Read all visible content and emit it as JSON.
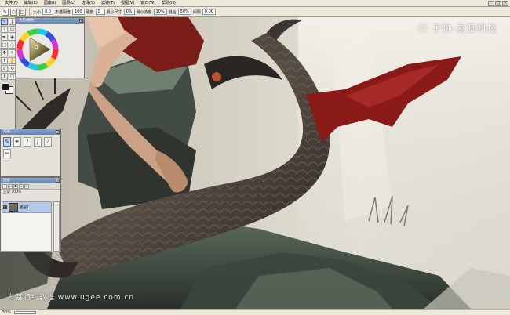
{
  "menubar": {
    "items": [
      "文件(F)",
      "编辑(E)",
      "图像(I)",
      "图层(L)",
      "选择(S)",
      "滤镜(T)",
      "视图(V)",
      "窗口(W)",
      "帮助(H)"
    ],
    "window_controls": [
      "_",
      "□",
      "×"
    ]
  },
  "optionsbar": {
    "size_label": "大小",
    "size_value": "8.0",
    "opacity_label": "不透明度",
    "opacity_value": "100",
    "hardness_label": "硬度",
    "hardness_value": "0",
    "min_size_label": "最小尺寸",
    "min_size_value": "0%",
    "min_density_label": "最小浓度",
    "min_density_value": "10%",
    "blend_label": "混合",
    "blend_value": "50%",
    "spacing_label": "间隔",
    "spacing_value": "0.00"
  },
  "palettes": {
    "colorwheel_title": "色轮/颜色",
    "brush_title": "笔刷",
    "layer_title": "图层",
    "layer_mode": "正常",
    "layer_opacity": "100%",
    "layer_name": "图层1"
  },
  "watermark": {
    "top": "ⓒ 子翀-友基科技",
    "bottom": "友基特约教程 www.ugee.com.cn"
  },
  "statusbar": {
    "zoom": "50%"
  },
  "colors": {
    "ui_bg": "#ece9d8",
    "panel_title": "#6384bb",
    "active_layer": "#b3c7e8",
    "foreground": "#1a1a1a",
    "background": "#ffffff",
    "accent_red": "#8a1a18"
  },
  "tools": {
    "icons": [
      "pencil-icon",
      "brush-icon",
      "airbrush-icon",
      "eraser-icon",
      "pen-icon",
      "fill-icon",
      "marquee-icon",
      "lasso-icon",
      "move-icon",
      "magic-wand-icon",
      "eyedropper-icon",
      "hand-icon",
      "zoom-icon",
      "rotate-icon",
      "text-icon",
      "shape-icon"
    ]
  }
}
